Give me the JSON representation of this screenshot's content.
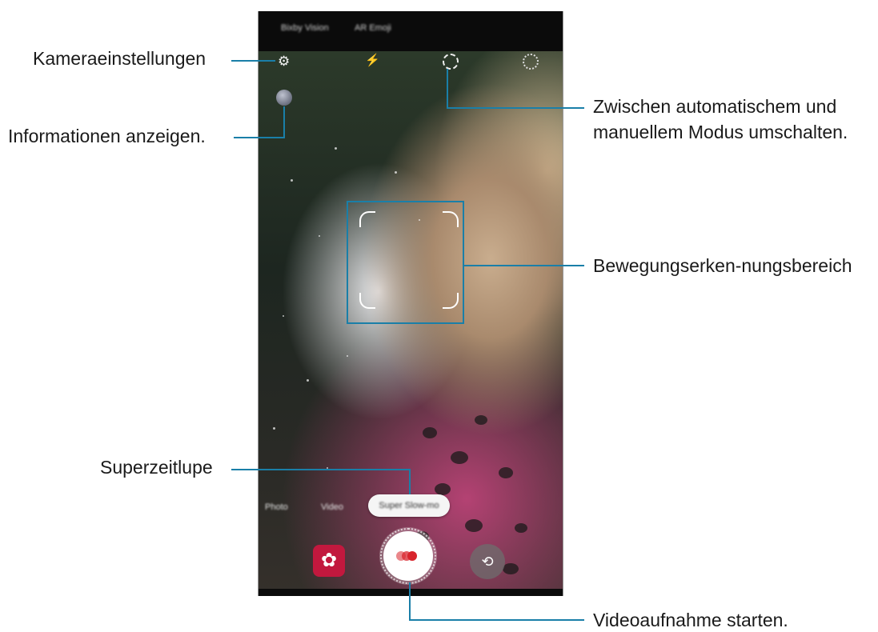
{
  "callouts": {
    "settings": "Kameraeinstellungen",
    "info": "Informationen anzeigen.",
    "auto_manual_line1": "Zwischen automatischem und",
    "auto_manual_line2": "manuellem Modus umschalten.",
    "detection_area": "Bewegungserken-nungsbereich",
    "super_slow": "Superzeitlupe",
    "start_recording": "Videoaufnahme starten."
  },
  "camera": {
    "top_modes": [
      "Bixby Vision",
      "AR Emoji"
    ],
    "icons": {
      "settings": "gear-icon",
      "flash": "flash-off-icon",
      "mode_toggle": "auto-detect-icon",
      "ratio": "aspect-ratio-icon",
      "gallery": "gallery-flower-icon",
      "record": "super-slow-record-icon",
      "switch": "switch-camera-icon"
    },
    "bottom_modes": [
      "Photo",
      "Video"
    ],
    "selected_mode": "Super Slow-mo"
  },
  "colors": {
    "callout_line": "#1a7fa8",
    "gallery_button": "#c2183e",
    "record_dot": "#d8242c"
  }
}
